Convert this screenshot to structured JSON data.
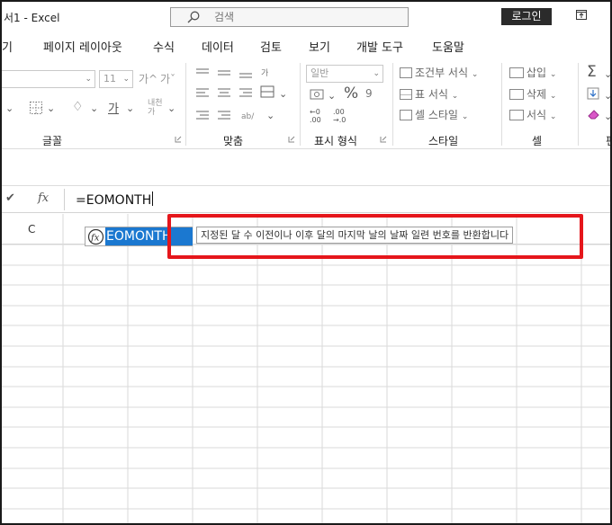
{
  "titlebar": {
    "title": "서1 - Excel",
    "search_placeholder": "검색",
    "login_label": "로그인"
  },
  "menu": {
    "items": [
      {
        "label": "기"
      },
      {
        "label": "페이지 레이아웃"
      },
      {
        "label": "수식"
      },
      {
        "label": "데이터"
      },
      {
        "label": "검토"
      },
      {
        "label": "보기"
      },
      {
        "label": "개발 도구"
      },
      {
        "label": "도움말"
      }
    ]
  },
  "ribbon": {
    "font": {
      "size_value": "11",
      "group_label": "글꼴"
    },
    "alignment": {
      "group_label": "맞춤"
    },
    "number": {
      "format_value": "일반",
      "group_label": "표시 형식"
    },
    "styles": {
      "conditional_label": "조건부 서식",
      "table_label": "표 서식",
      "cell_style_label": "셀 스타일",
      "group_label": "스타일"
    },
    "cells": {
      "insert_label": "삽입",
      "delete_label": "삭제",
      "format_label": "서식",
      "group_label": "셀"
    },
    "editing": {
      "group_label": "편"
    }
  },
  "formula_bar": {
    "value": "=EOMONTH"
  },
  "grid": {
    "column_header": "C"
  },
  "autocomplete": {
    "function_name": "EOMONTH",
    "tooltip": "지정된 달 수 이전이나 이후 달의 마지막 날의 날짜 일련 번호를 반환합니다"
  },
  "colors": {
    "selection_blue": "#1b78d0",
    "highlight_red": "#e5161b",
    "login_bg": "#2b2b2b"
  }
}
